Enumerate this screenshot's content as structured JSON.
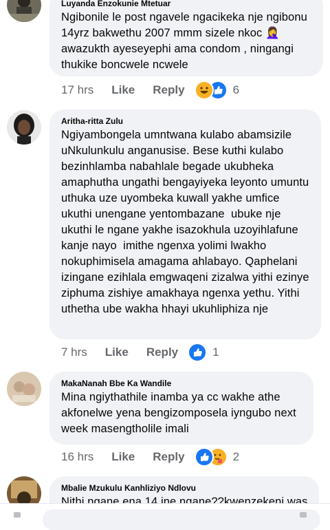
{
  "comments": [
    {
      "author": "Luyanda Enzokunie Mtetuar",
      "text": "Ngibonile le post ngavele ngacikeka nje ngibonu 14yrz bakwethu 2007 mmm sizele nkoc 🤦‍♀️ awazukth ayeseyephi ama condom , ningangi thukike boncwele ncwele",
      "time": "17 hrs",
      "like": "Like",
      "reply": "Reply",
      "reaction_count": "6",
      "reactions": [
        "haha-icon",
        "like-icon"
      ]
    },
    {
      "author": "Aritha-ritta Zulu",
      "text": "Ngiyambongela umntwana kulabo abamsizile uNkulunkulu anganusise. Bese kuthi kulabo bezinhlamba nabahlale begade ukubheka amaphutha ungathi bengayiyeka leyonto umuntu uthuka uze uyombeka kuwall yakhe umfice ukuthi unengane yentombazane  ubuke nje ukuthi le ngane yakhe isazokhula uzoyihlafune kanje nayo  imithe ngenxa yolimi lwakho nokuphimisela amagama ahlabayo. Qaphelani izingane ezihlala emgwaqeni zizalwa yithi ezinye ziphuma zishiye amakhaya ngenxa yethu. Yithi uthetha ube wakha hhayi ukuhliphiza nje",
      "time": "7 hrs",
      "like": "Like",
      "reply": "Reply",
      "reaction_count": "1",
      "reactions": [
        "like-icon"
      ]
    },
    {
      "author": "MakaNanah Bbe Ka Wandile",
      "text": "Mina ngiythathile inamba ya cc wakhe athe akfonelwe yena bengizomposela iyngubo next week masengtholile imali",
      "time": "16 hrs",
      "like": "Like",
      "reply": "Reply",
      "reaction_count": "2",
      "reactions": [
        "like-icon",
        "care-icon"
      ]
    },
    {
      "author": "Mbalie Mzukulu Kanhliziyo Ndlovu",
      "text": "Nithi ngane ena 14 ine ngane??kwenzekeni was"
    }
  ],
  "colors": {
    "bubble": "#f0f2f5",
    "meta": "#65676b",
    "like_blue": "#1877f2",
    "haha_yellow": "#f7b125"
  }
}
